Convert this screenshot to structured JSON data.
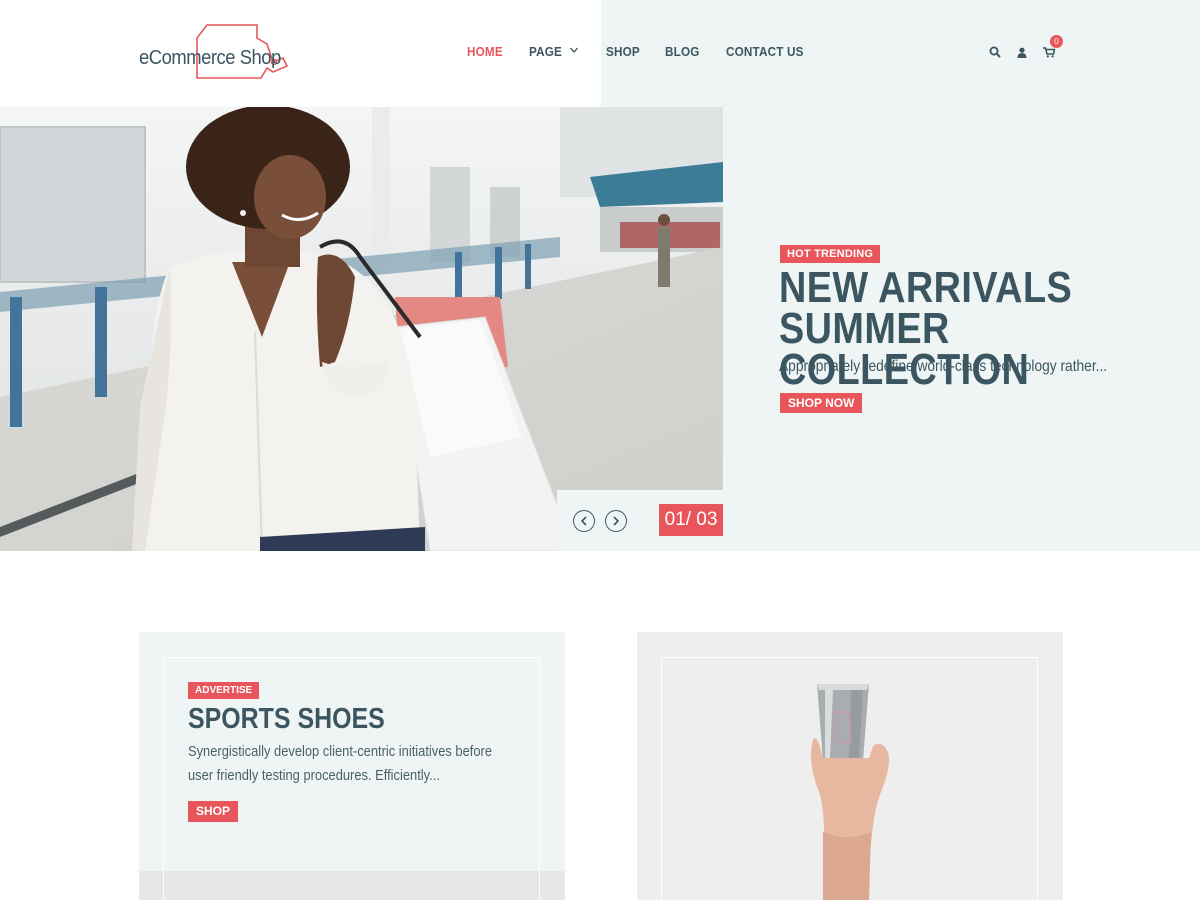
{
  "brand": {
    "logo_text": "eCommerce Shop"
  },
  "nav": {
    "items": [
      {
        "label": "HOME",
        "active": true
      },
      {
        "label": "PAGE",
        "has_dropdown": true
      },
      {
        "label": "SHOP"
      },
      {
        "label": "BLOG"
      },
      {
        "label": "CONTACT US"
      }
    ]
  },
  "header_icons": {
    "search": "search-icon",
    "user": "user-icon",
    "cart": "cart-icon",
    "cart_count": "0"
  },
  "hero": {
    "badge": "HOT TRENDING",
    "title": "NEW ARRIVALS SUMMER COLLECTION",
    "subtitle": "Appropriately redefine world-class technology rather...",
    "button": "SHOP NOW",
    "counter": "01/ 03",
    "image": "woman-with-shopping-bags-photo"
  },
  "cards": [
    {
      "badge": "ADVERTISE",
      "title": "SPORTS SHOES",
      "description": "Synergistically develop client-centric initiatives before user friendly testing procedures. Efficiently...",
      "button": "SHOP"
    },
    {
      "image": "hand-holding-travel-cup-photo"
    }
  ],
  "colors": {
    "accent": "#e8555a",
    "text": "#3b5660",
    "panel": "#eef5f4"
  }
}
